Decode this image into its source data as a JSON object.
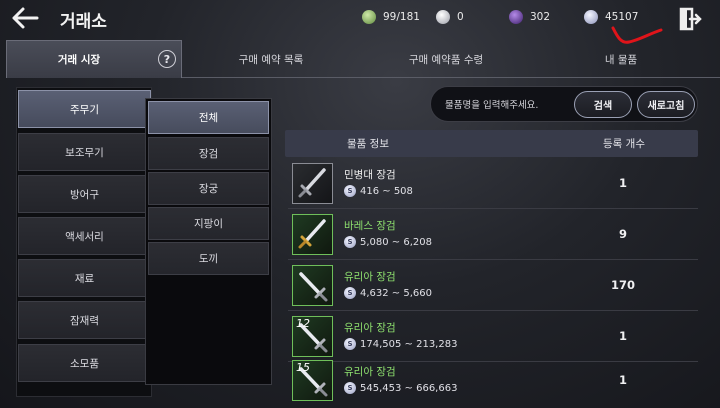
{
  "header": {
    "title": "거래소",
    "resources": [
      {
        "name": "bag-capacity",
        "value": "99/181",
        "color": "#8fb86a"
      },
      {
        "name": "gold",
        "value": "0",
        "color": "#cfd1d8"
      },
      {
        "name": "purple-gem",
        "value": "302",
        "color": "#6a3fa8"
      },
      {
        "name": "silver",
        "value": "45107",
        "color": "#a6acd0"
      }
    ]
  },
  "tabs": [
    {
      "label": "거래 시장",
      "active": true
    },
    {
      "label": "구매 예약 목록"
    },
    {
      "label": "구매 예약품 수령"
    },
    {
      "label": "내 물품"
    }
  ],
  "help_label": "?",
  "categories": [
    "주무기",
    "보조무기",
    "방어구",
    "액세서리",
    "재료",
    "잠재력",
    "소모품"
  ],
  "subcategories": [
    "전체",
    "장검",
    "장궁",
    "지팡이",
    "도끼"
  ],
  "search": {
    "placeholder": "물품명을 입력해주세요.",
    "search_label": "검색",
    "refresh_label": "새로고침"
  },
  "table": {
    "col_item": "물품 정보",
    "col_count": "등록 개수",
    "rows": [
      {
        "name": "민병대 장검",
        "price": "416 ~ 508",
        "count": "1",
        "grade": "normal",
        "enhance": ""
      },
      {
        "name": "바레스 장검",
        "price": "5,080 ~ 6,208",
        "count": "9",
        "grade": "uncommon",
        "enhance": ""
      },
      {
        "name": "유리아 장검",
        "price": "4,632 ~ 5,660",
        "count": "170",
        "grade": "uncommon",
        "enhance": ""
      },
      {
        "name": "유리아 장검",
        "price": "174,505 ~ 213,283",
        "count": "1",
        "grade": "uncommon",
        "enhance": "12"
      },
      {
        "name": "유리아 장검",
        "price": "545,453 ~ 666,663",
        "count": "1",
        "grade": "uncommon",
        "enhance": "15"
      }
    ]
  },
  "colors": {
    "uncommon": "#8ee06e",
    "active_tab": "#4a4d58",
    "annotation": "#e0141a"
  },
  "icons": [
    "back-arrow-icon",
    "exit-door-icon",
    "silver-coin-icon",
    "sword-icon"
  ]
}
